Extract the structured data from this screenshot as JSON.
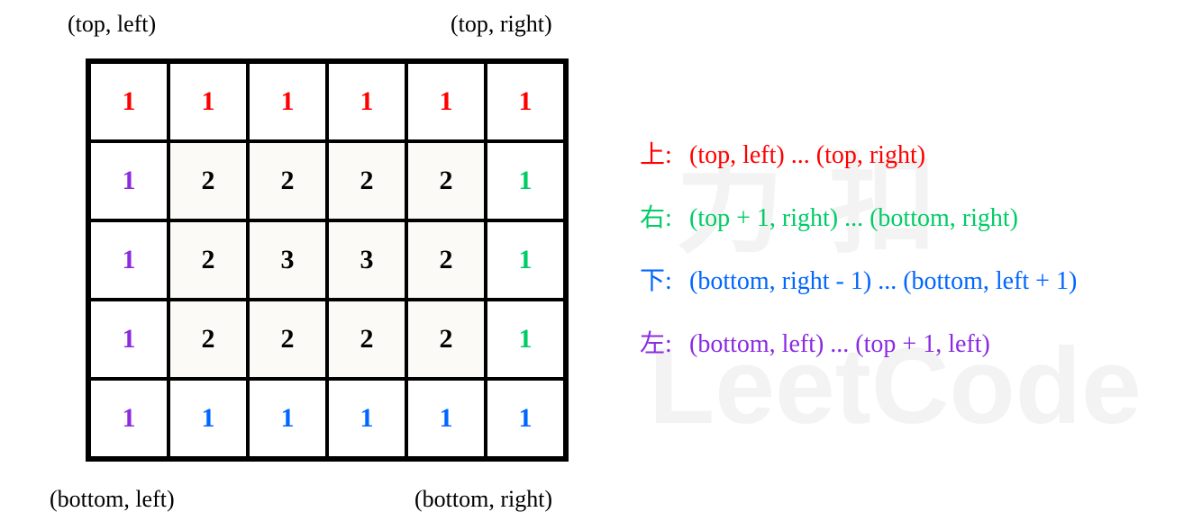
{
  "corners": {
    "top_left": "(top, left)",
    "top_right": "(top, right)",
    "bottom_left": "(bottom, left)",
    "bottom_right": "(bottom, right)"
  },
  "grid": {
    "rows": 5,
    "cols": 6,
    "cells": [
      [
        {
          "v": "1",
          "c": "red"
        },
        {
          "v": "1",
          "c": "red"
        },
        {
          "v": "1",
          "c": "red"
        },
        {
          "v": "1",
          "c": "red"
        },
        {
          "v": "1",
          "c": "red"
        },
        {
          "v": "1",
          "c": "red"
        }
      ],
      [
        {
          "v": "1",
          "c": "purple"
        },
        {
          "v": "2",
          "c": "black",
          "s": true
        },
        {
          "v": "2",
          "c": "black",
          "s": true
        },
        {
          "v": "2",
          "c": "black",
          "s": true
        },
        {
          "v": "2",
          "c": "black",
          "s": true
        },
        {
          "v": "1",
          "c": "green"
        }
      ],
      [
        {
          "v": "1",
          "c": "purple"
        },
        {
          "v": "2",
          "c": "black",
          "s": true
        },
        {
          "v": "3",
          "c": "black",
          "s": true
        },
        {
          "v": "3",
          "c": "black",
          "s": true
        },
        {
          "v": "2",
          "c": "black",
          "s": true
        },
        {
          "v": "1",
          "c": "green"
        }
      ],
      [
        {
          "v": "1",
          "c": "purple"
        },
        {
          "v": "2",
          "c": "black",
          "s": true
        },
        {
          "v": "2",
          "c": "black",
          "s": true
        },
        {
          "v": "2",
          "c": "black",
          "s": true
        },
        {
          "v": "2",
          "c": "black",
          "s": true
        },
        {
          "v": "1",
          "c": "green"
        }
      ],
      [
        {
          "v": "1",
          "c": "purple"
        },
        {
          "v": "1",
          "c": "blue"
        },
        {
          "v": "1",
          "c": "blue"
        },
        {
          "v": "1",
          "c": "blue"
        },
        {
          "v": "1",
          "c": "blue"
        },
        {
          "v": "1",
          "c": "blue"
        }
      ]
    ]
  },
  "legend": {
    "top": {
      "label": "上:",
      "range": "(top, left) ... (top, right)",
      "color": "#ff0000"
    },
    "right": {
      "label": "右:",
      "range": "(top + 1, right) ... (bottom, right)",
      "color": "#00cc66"
    },
    "bottom": {
      "label": "下:",
      "range": "(bottom, right - 1) ... (bottom, left + 1)",
      "color": "#0066ff"
    },
    "left": {
      "label": "左:",
      "range": "(bottom, left) ... (top + 1, left)",
      "color": "#8a2be2"
    }
  },
  "watermark": {
    "line1": "力扣",
    "line2": "LeetCode"
  },
  "color_map": {
    "red": "#ff0000",
    "green": "#00cc66",
    "blue": "#0066ff",
    "purple": "#8a2be2",
    "black": "#000000"
  }
}
